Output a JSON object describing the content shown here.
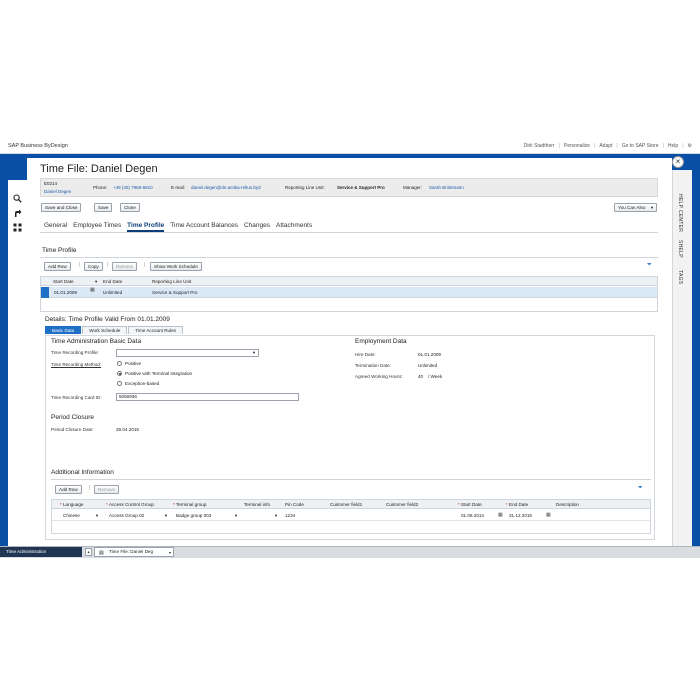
{
  "shell": {
    "brand": "SAP Business ByDesign",
    "user": "Dirk Stadtherr",
    "links": [
      "Personalize",
      "Adapt",
      "Go to SAP Store",
      "Help"
    ]
  },
  "left_rail": {
    "icons": [
      "search-icon",
      "share-icon",
      "hierarchy-icon"
    ]
  },
  "right_rail": {
    "labels": [
      "HELP CENTER",
      "SHELP",
      "TAGS"
    ]
  },
  "header": {
    "title": "Time File: Daniel Degen",
    "employee_id": "E0214",
    "employee_name": "Daniel Degen",
    "phone_label": "Phone:",
    "phone": "+49 (40) 7968-6810",
    "email_label": "E-mail:",
    "email": "daniel.degen@de.amika-reltus.byd",
    "line_unit_label": "Reporting Line Unit:",
    "line_unit": "Service & Support Pro",
    "manager_label": "Manager:",
    "manager": "Sarah Brinkmann"
  },
  "toolbar": {
    "save_close": "Save and Close",
    "save": "Save",
    "close": "Close",
    "you_can_also": "You Can Also"
  },
  "tabs": [
    "General",
    "Employee Times",
    "Time Profile",
    "Time Account Balances",
    "Changes",
    "Attachments"
  ],
  "time_profile": {
    "title": "Time Profile",
    "buttons": {
      "add_row": "Add Row",
      "copy": "Copy",
      "remove": "Remove",
      "show_schedule": "Show Work Schedule"
    },
    "columns": [
      "Start Date",
      "End Date",
      "Reporting Line Unit"
    ],
    "rows": [
      {
        "start": "01.01.2009",
        "end": "Unlimited",
        "unit": "Service & Support Pro"
      }
    ]
  },
  "details": {
    "title": "Details: Time Profile Valid From 01.01.2009",
    "subtabs": [
      "Basic Data",
      "Work Schedule",
      "Time Account Rules"
    ],
    "time_admin": {
      "title": "Time Administration Basic Data",
      "profile_label": "Time Recording Profile:",
      "method_label": "Time Recording Method:",
      "methods": [
        "Positive",
        "Positive with Terminal Integration",
        "Exception-based"
      ],
      "card_label": "Time Recording Card ID:",
      "card_value": "5056936"
    },
    "employment": {
      "title": "Employment Data",
      "hire_label": "Hire Date:",
      "hire_value": "01.01.2009",
      "term_label": "Termination Date:",
      "term_value": "Unlimited",
      "hours_label": "Agreed Working Hours:",
      "hours_value": "40",
      "hours_unit": "/ Week"
    },
    "closure": {
      "title": "Period Closure",
      "date_label": "Period Closure Date:",
      "date_value": "29.04.2015"
    },
    "additional": {
      "title": "Additional Information",
      "add_row": "Add Row",
      "remove": "Remove",
      "columns": [
        "Language",
        "Access Control Group",
        "Terminal group",
        "Terminal info",
        "Pin Code",
        "Customer field1",
        "Customer field2",
        "Start Date",
        "End Date",
        "Description"
      ],
      "row": {
        "language": "Chinese",
        "access_group": "Access Group 02",
        "terminal_group": "Badge group 003",
        "terminal_info": "",
        "pin": "1234",
        "c1": "",
        "c2": "",
        "start": "01.06.2014",
        "end": "31.12.2015",
        "desc": ""
      }
    }
  },
  "taskbar": {
    "left": "Time Administration",
    "doc": "Time File: Daniel Deg"
  },
  "colors": {
    "frame_blue": "#0a4fa6",
    "accent_blue": "#1f6fc7"
  }
}
